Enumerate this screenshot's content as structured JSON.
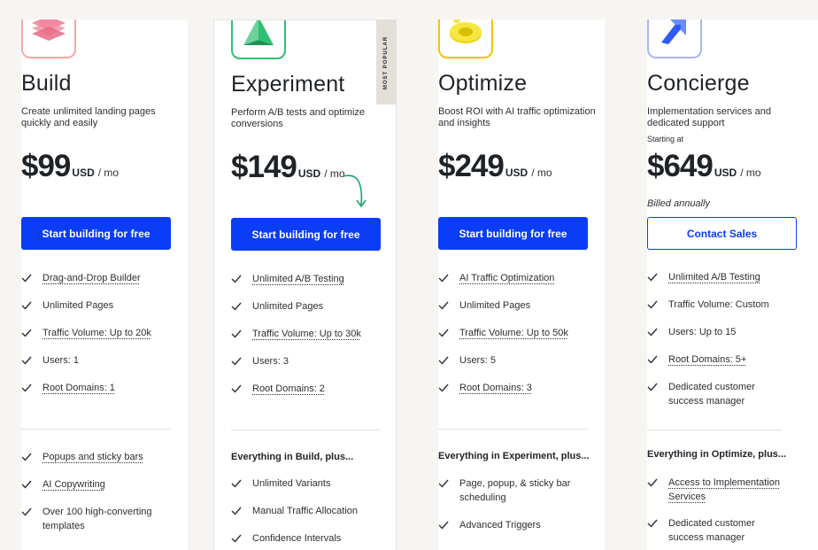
{
  "plans": [
    {
      "title": "Build",
      "description": "Create unlimited landing pages quickly and easily",
      "price": "$99",
      "currency": "USD",
      "period": "/ mo",
      "cta": "Start building for free",
      "features": [
        "Drag-and-Drop Builder",
        "Unlimited Pages",
        "Traffic Volume: Up to 20k",
        "Users: 1",
        "Root Domains: 1"
      ],
      "extras": [
        "Popups and sticky bars",
        "AI Copywriting",
        "Over 100 high-converting templates"
      ]
    },
    {
      "title": "Experiment",
      "badge": "MOST POPULAR",
      "description": "Perform A/B tests and optimize conversions",
      "price": "$149",
      "currency": "USD",
      "period": "/ mo",
      "cta": "Start building for free",
      "features": [
        "Unlimited A/B Testing",
        "Unlimited Pages",
        "Traffic Volume: Up to 30k",
        "Users: 3",
        "Root Domains: 2"
      ],
      "extras_heading": "Everything in Build, plus...",
      "extras": [
        "Unlimited Variants",
        "Manual Traffic Allocation",
        "Confidence Intervals"
      ]
    },
    {
      "title": "Optimize",
      "description": "Boost ROI with AI traffic optimization and insights",
      "price": "$249",
      "currency": "USD",
      "period": "/ mo",
      "cta": "Start building for free",
      "features": [
        "AI Traffic Optimization",
        "Unlimited Pages",
        "Traffic Volume: Up to 50k",
        "Users: 5",
        "Root Domains: 3"
      ],
      "extras_heading": "Everything in Experiment, plus...",
      "extras": [
        "Page, popup, & sticky bar scheduling",
        "Advanced Triggers"
      ]
    },
    {
      "title": "Concierge",
      "description": "Implementation services and dedicated support",
      "starting": "Starting at",
      "price": "$649",
      "currency": "USD",
      "period": "/ mo",
      "billed": "Billed annually",
      "cta": "Contact Sales",
      "features": [
        "Unlimited A/B Testing",
        "Traffic Volume: Custom",
        "Users: Up to 15",
        "Root Domains: 5+",
        "Dedicated customer success manager"
      ],
      "extras_heading": "Everything in Optimize, plus...",
      "extras": [
        "Access to Implementation Services",
        "Dedicated customer success manager"
      ]
    }
  ],
  "colors": {
    "accent": "#0a3df5",
    "build_icon": "#f6a8a8",
    "experiment_icon": "#2fbf71",
    "optimize_icon": "#f2c300",
    "concierge_icon": "#a9b6f5"
  }
}
